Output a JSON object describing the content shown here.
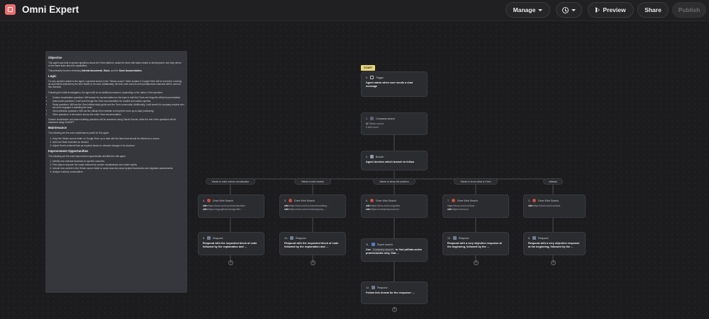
{
  "app": {
    "title": "Omni Expert",
    "buttons": {
      "manage": "Manage",
      "preview": "Preview",
      "share": "Share",
      "publish": "Publish"
    },
    "accent": "#ee6e6e"
  },
  "notes": {
    "objective_heading": "Objective",
    "objective_p1": "This agent was built to answer questions about the Omni platform, assist the team with tasks related to development, and help others on the team learn about its capabilities.",
    "objective_p2_pre": "That primarily involves reviewing ",
    "objective_p2_bold1": "Internal documents",
    "objective_p2_mid": ", ",
    "objective_p2_bold2": "Slack",
    "objective_p2_and": ", and the ",
    "objective_p2_bold3": "Omni documentation",
    "objective_p2_end": ".",
    "logic_heading": "Logic",
    "logic_p1": "For any question asked to the agent, a general search in the \"Gleam source\" folder located in Google Drive will be executed, covering all documents selected by the tech leader to be used. Additionally, the tech-omni and ext-omni-phdata-team channels will be used for this research.",
    "logic_p2": "Following the initial investigation, the agent will do an additional research, depending on the nature of the question:",
    "logic_items": [
      "Custom visualization questions: Will search for documentation on the topic in both the Omni and Vega-lite official documentation.",
      "Data model questions: It will look through the Omni documentation for models and custom queries.",
      "Study questions: Will use the Omni official study guide and the Omni community. Additionally, it will search for company experts who are more engaged in assisting the team.",
      "Omni definition questions: Will use the official Omni website to bring their more up-to-date positioning.",
      "Other questions: It will search across the entire Omni documentation."
    ],
    "logic_p3": "Custom visualization and data modelling questions will be answered using Claude Sonnet, while the rest of the questions will be answered using ChatGPT.",
    "maintenance_heading": "Maintenance",
    "maintenance_p": "The following are the main maintenance points for this agent.",
    "maintenance_items": [
      "Keep the Gleam source folder on Google Drive up to date with the items that should be utilized as a source.",
      "Add new Slack channels as needed.",
      "Adjust Omni's external links as required based on relevant changes in its structure."
    ],
    "improvement_heading": "Improvement Opportunities",
    "improvement_p": "The following are the main improvement opportunities identified for this agent.",
    "improvement_items": [
      "Identify new relevant branches for specific searches.",
      "Find ways to improve the nodes returned by custom visualizations and model replies.",
      "Include new content in the Gleam source folder to assist searches about project frameworks and migration assessments.",
      "Analyze memory consumption."
    ]
  },
  "flow": {
    "start_label": "START",
    "trigger": {
      "num": "0.",
      "type": "Trigger",
      "body": "Agent starts when user sends a chat message"
    },
    "company_search": {
      "num": "1.",
      "type": "Company search",
      "line1": "Gleam source",
      "line2": "tech-omni"
    },
    "branch": {
      "num": "2.",
      "type": "Branch",
      "body": "Agent decides which branch to follow"
    },
    "edge_labels": [
      "Wants to build custom visualization",
      "Wants to edit models",
      "Wants to study the platform",
      "Wants to know what is Omni",
      "fallback"
    ],
    "browse_nodes": [
      {
        "num": "4.",
        "type": "Drive Web Search",
        "k1": "site:",
        "v1": "https://docs.omni.co/docs/visualiza...",
        "k2": "site:",
        "v2": "https://vega.github.io/vega-lite/..."
      },
      {
        "num": "5.",
        "type": "Drive Web Search",
        "k1": "site:",
        "v1": "https://docs.omni.co/docs/modeling...",
        "k2": "site:",
        "v2": "https://docs.omni.co/docs/query-..."
      },
      {
        "num": "6.",
        "type": "Drive Web Search",
        "k1": "site:",
        "v1": "https://docs.omni.co/guides",
        "k2": "site:",
        "v2": "https://community.omni.co/"
      },
      {
        "num": "7.",
        "type": "Drive Web Search",
        "k1": "",
        "v1": "https://docs.omni.co/docs",
        "k2": "site:",
        "v2": "https://omni.co/"
      },
      {
        "num": "3.",
        "type": "Drive Web Search",
        "k1": "site:",
        "v1": "https://docs.omni.co/docs",
        "k2": "",
        "v2": ""
      }
    ],
    "respond_nodes": [
      {
        "num": "9.",
        "type": "Respond",
        "body": "Respond with the requested block of code followed by the explanation and ..."
      },
      {
        "num": "10.",
        "type": "Respond",
        "body": "Respond with the requested block of code followed by the explanation and ..."
      },
      {
        "num": "11.",
        "type": "Expert search",
        "pre": "Use",
        "tag": "Company search",
        "post": "to find phData active professionals only, that ..."
      },
      {
        "num": "12.",
        "type": "Respond",
        "body": "Respond with a very objective response at the beginning, followed by the ..."
      },
      {
        "num": "8.",
        "type": "Respond",
        "body": "Respond with a very objective response at the beginning, followed by the ..."
      }
    ],
    "final_node": {
      "num": "13.",
      "type": "Respond",
      "body": "Follow this format for the response: ..."
    },
    "plus_glyph": "+"
  }
}
